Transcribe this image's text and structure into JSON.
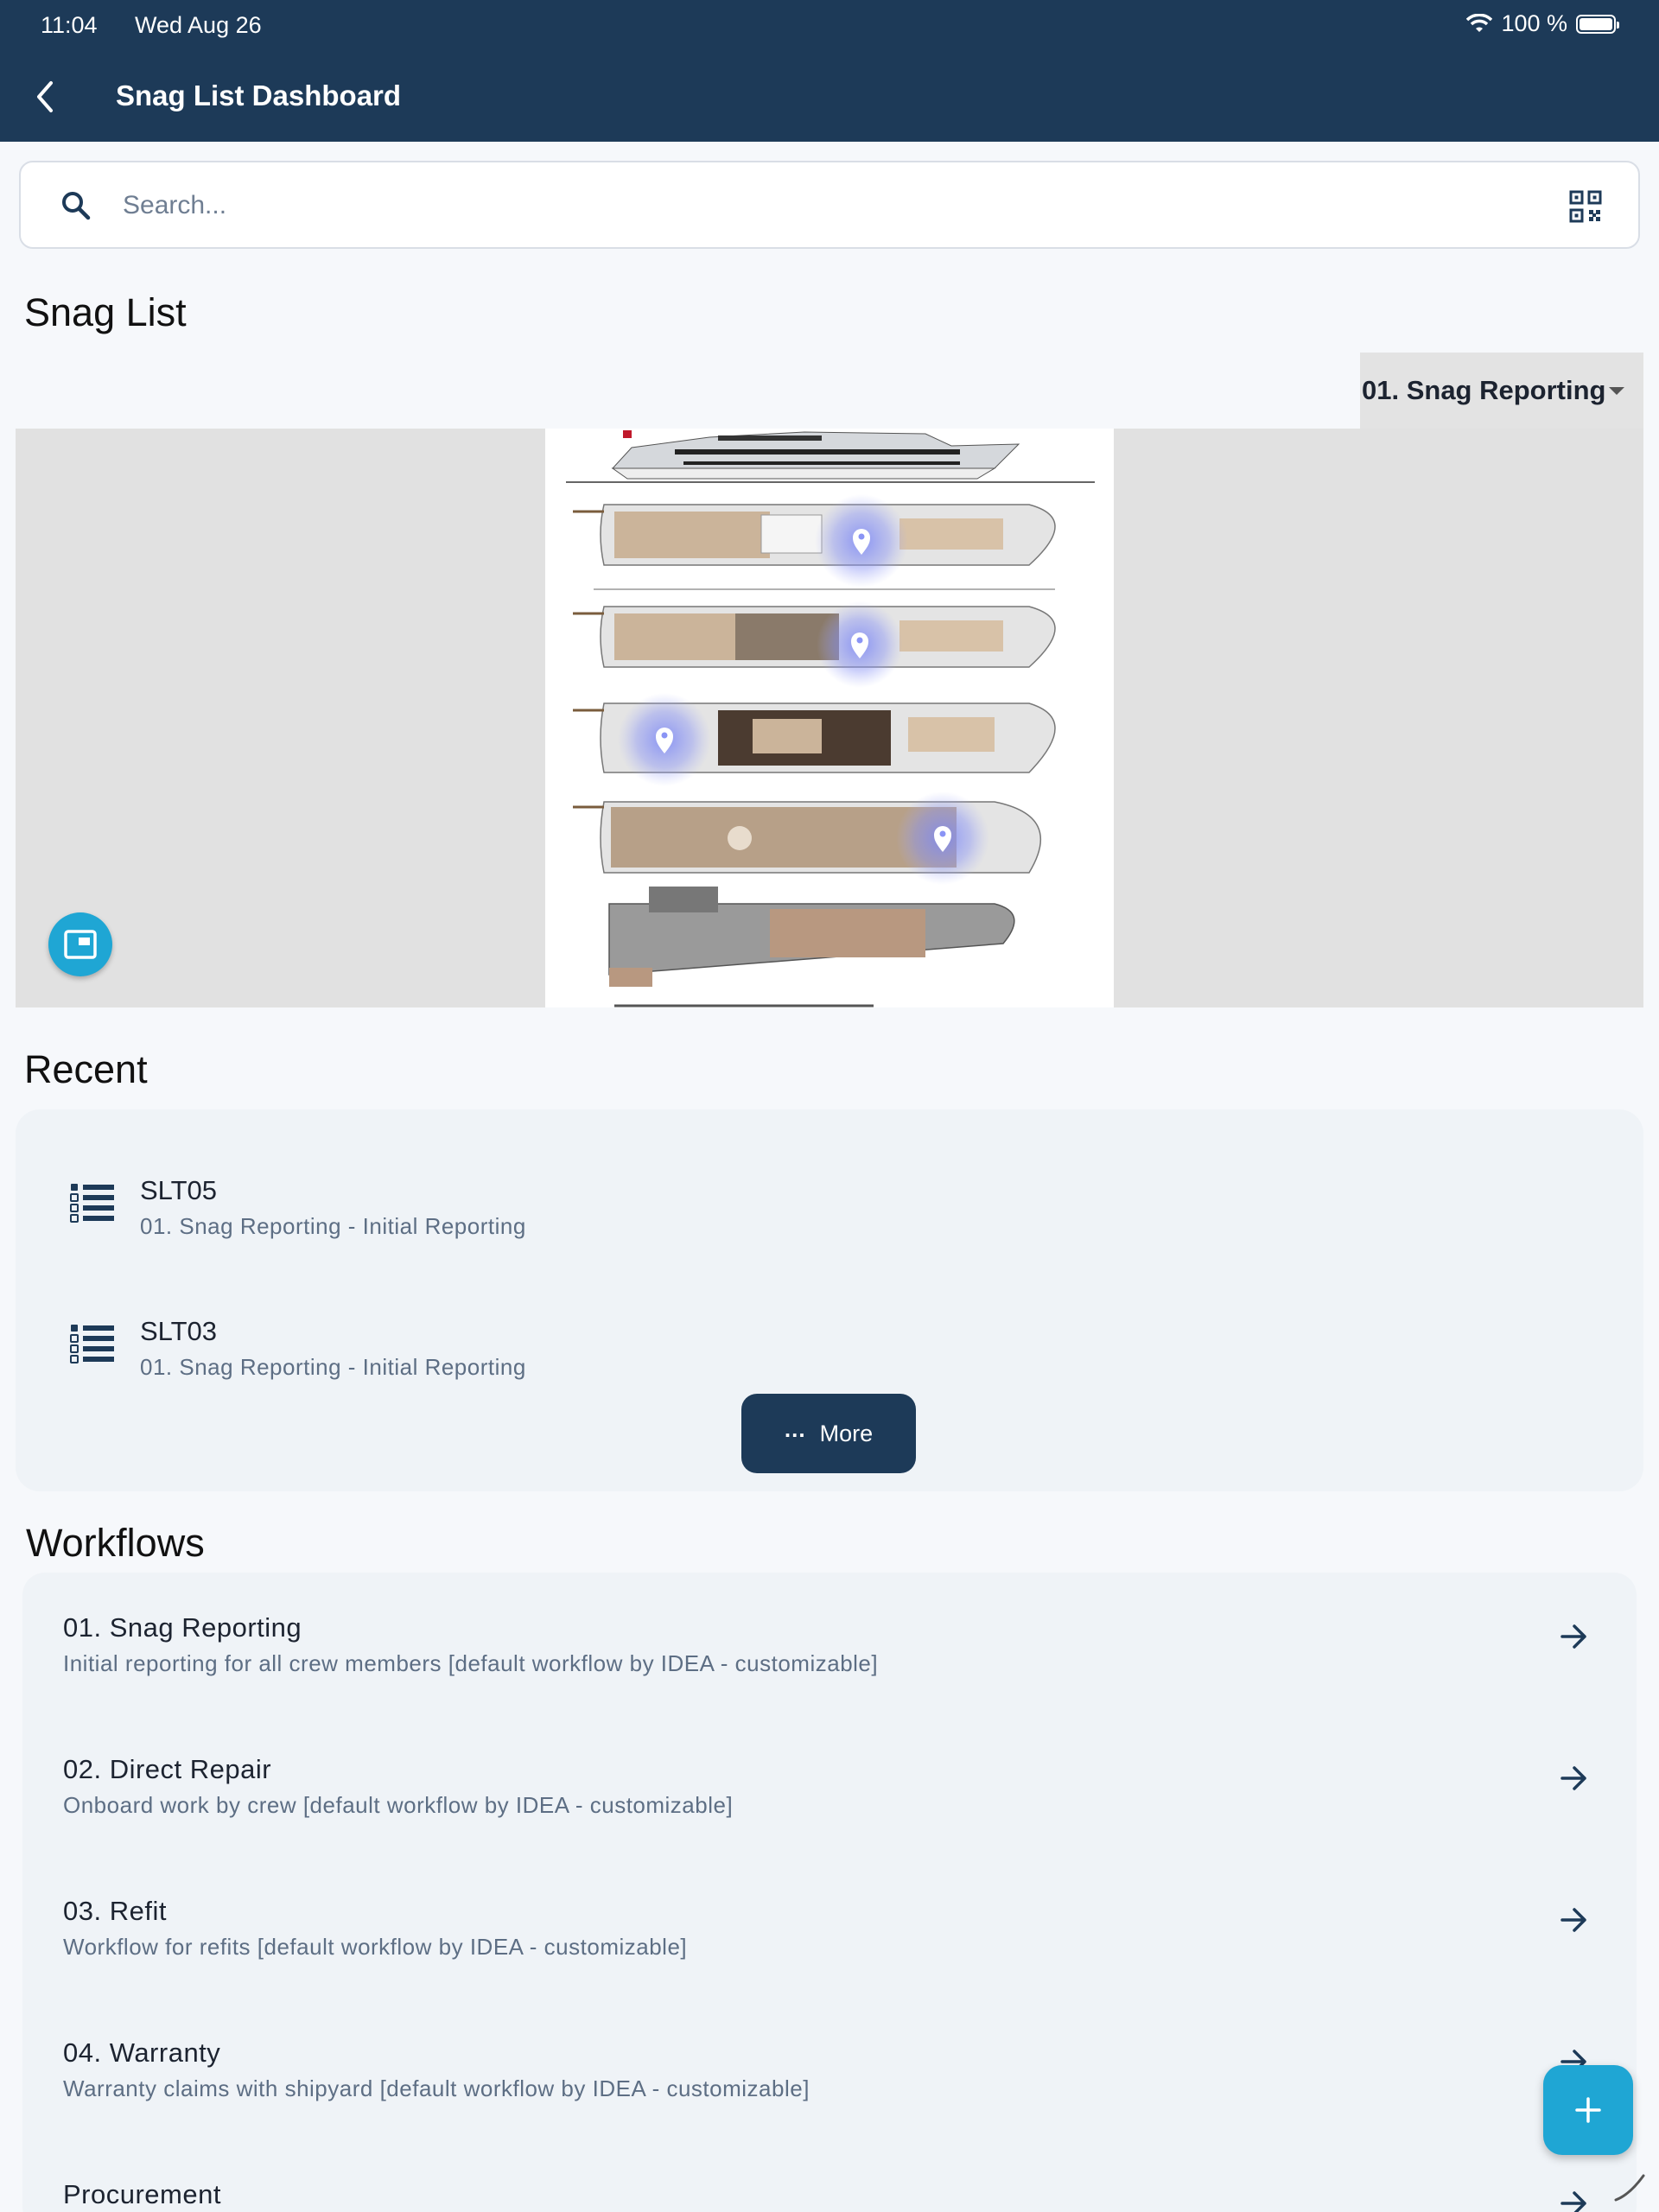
{
  "status_bar": {
    "time": "11:04",
    "date": "Wed Aug 26",
    "battery": "100 %"
  },
  "header": {
    "title": "Snag List Dashboard"
  },
  "search": {
    "placeholder": "Search..."
  },
  "snag_list": {
    "heading": "Snag List",
    "dropdown_value": "01. Snag Reporting"
  },
  "recent": {
    "heading": "Recent",
    "items": [
      {
        "title": "SLT05",
        "subtitle": "01. Snag Reporting - Initial Reporting"
      },
      {
        "title": "SLT03",
        "subtitle": "01. Snag Reporting - Initial Reporting"
      }
    ],
    "more_label": "More"
  },
  "workflows": {
    "heading": "Workflows",
    "items": [
      {
        "title": "01. Snag Reporting",
        "subtitle": "Initial reporting for all crew members [default workflow by IDEA - customizable]"
      },
      {
        "title": "02. Direct Repair",
        "subtitle": "Onboard work by crew [default workflow by IDEA - customizable]"
      },
      {
        "title": "03. Refit",
        "subtitle": "Workflow for refits [default workflow by IDEA - customizable]"
      },
      {
        "title": "04. Warranty",
        "subtitle": "Warranty claims with shipyard [default workflow by IDEA - customizable]"
      },
      {
        "title": "Procurement",
        "subtitle": ""
      }
    ]
  },
  "colors": {
    "primary": "#1d3a58",
    "accent": "#1fa6d4",
    "pin_glow": "#7a86f5"
  }
}
